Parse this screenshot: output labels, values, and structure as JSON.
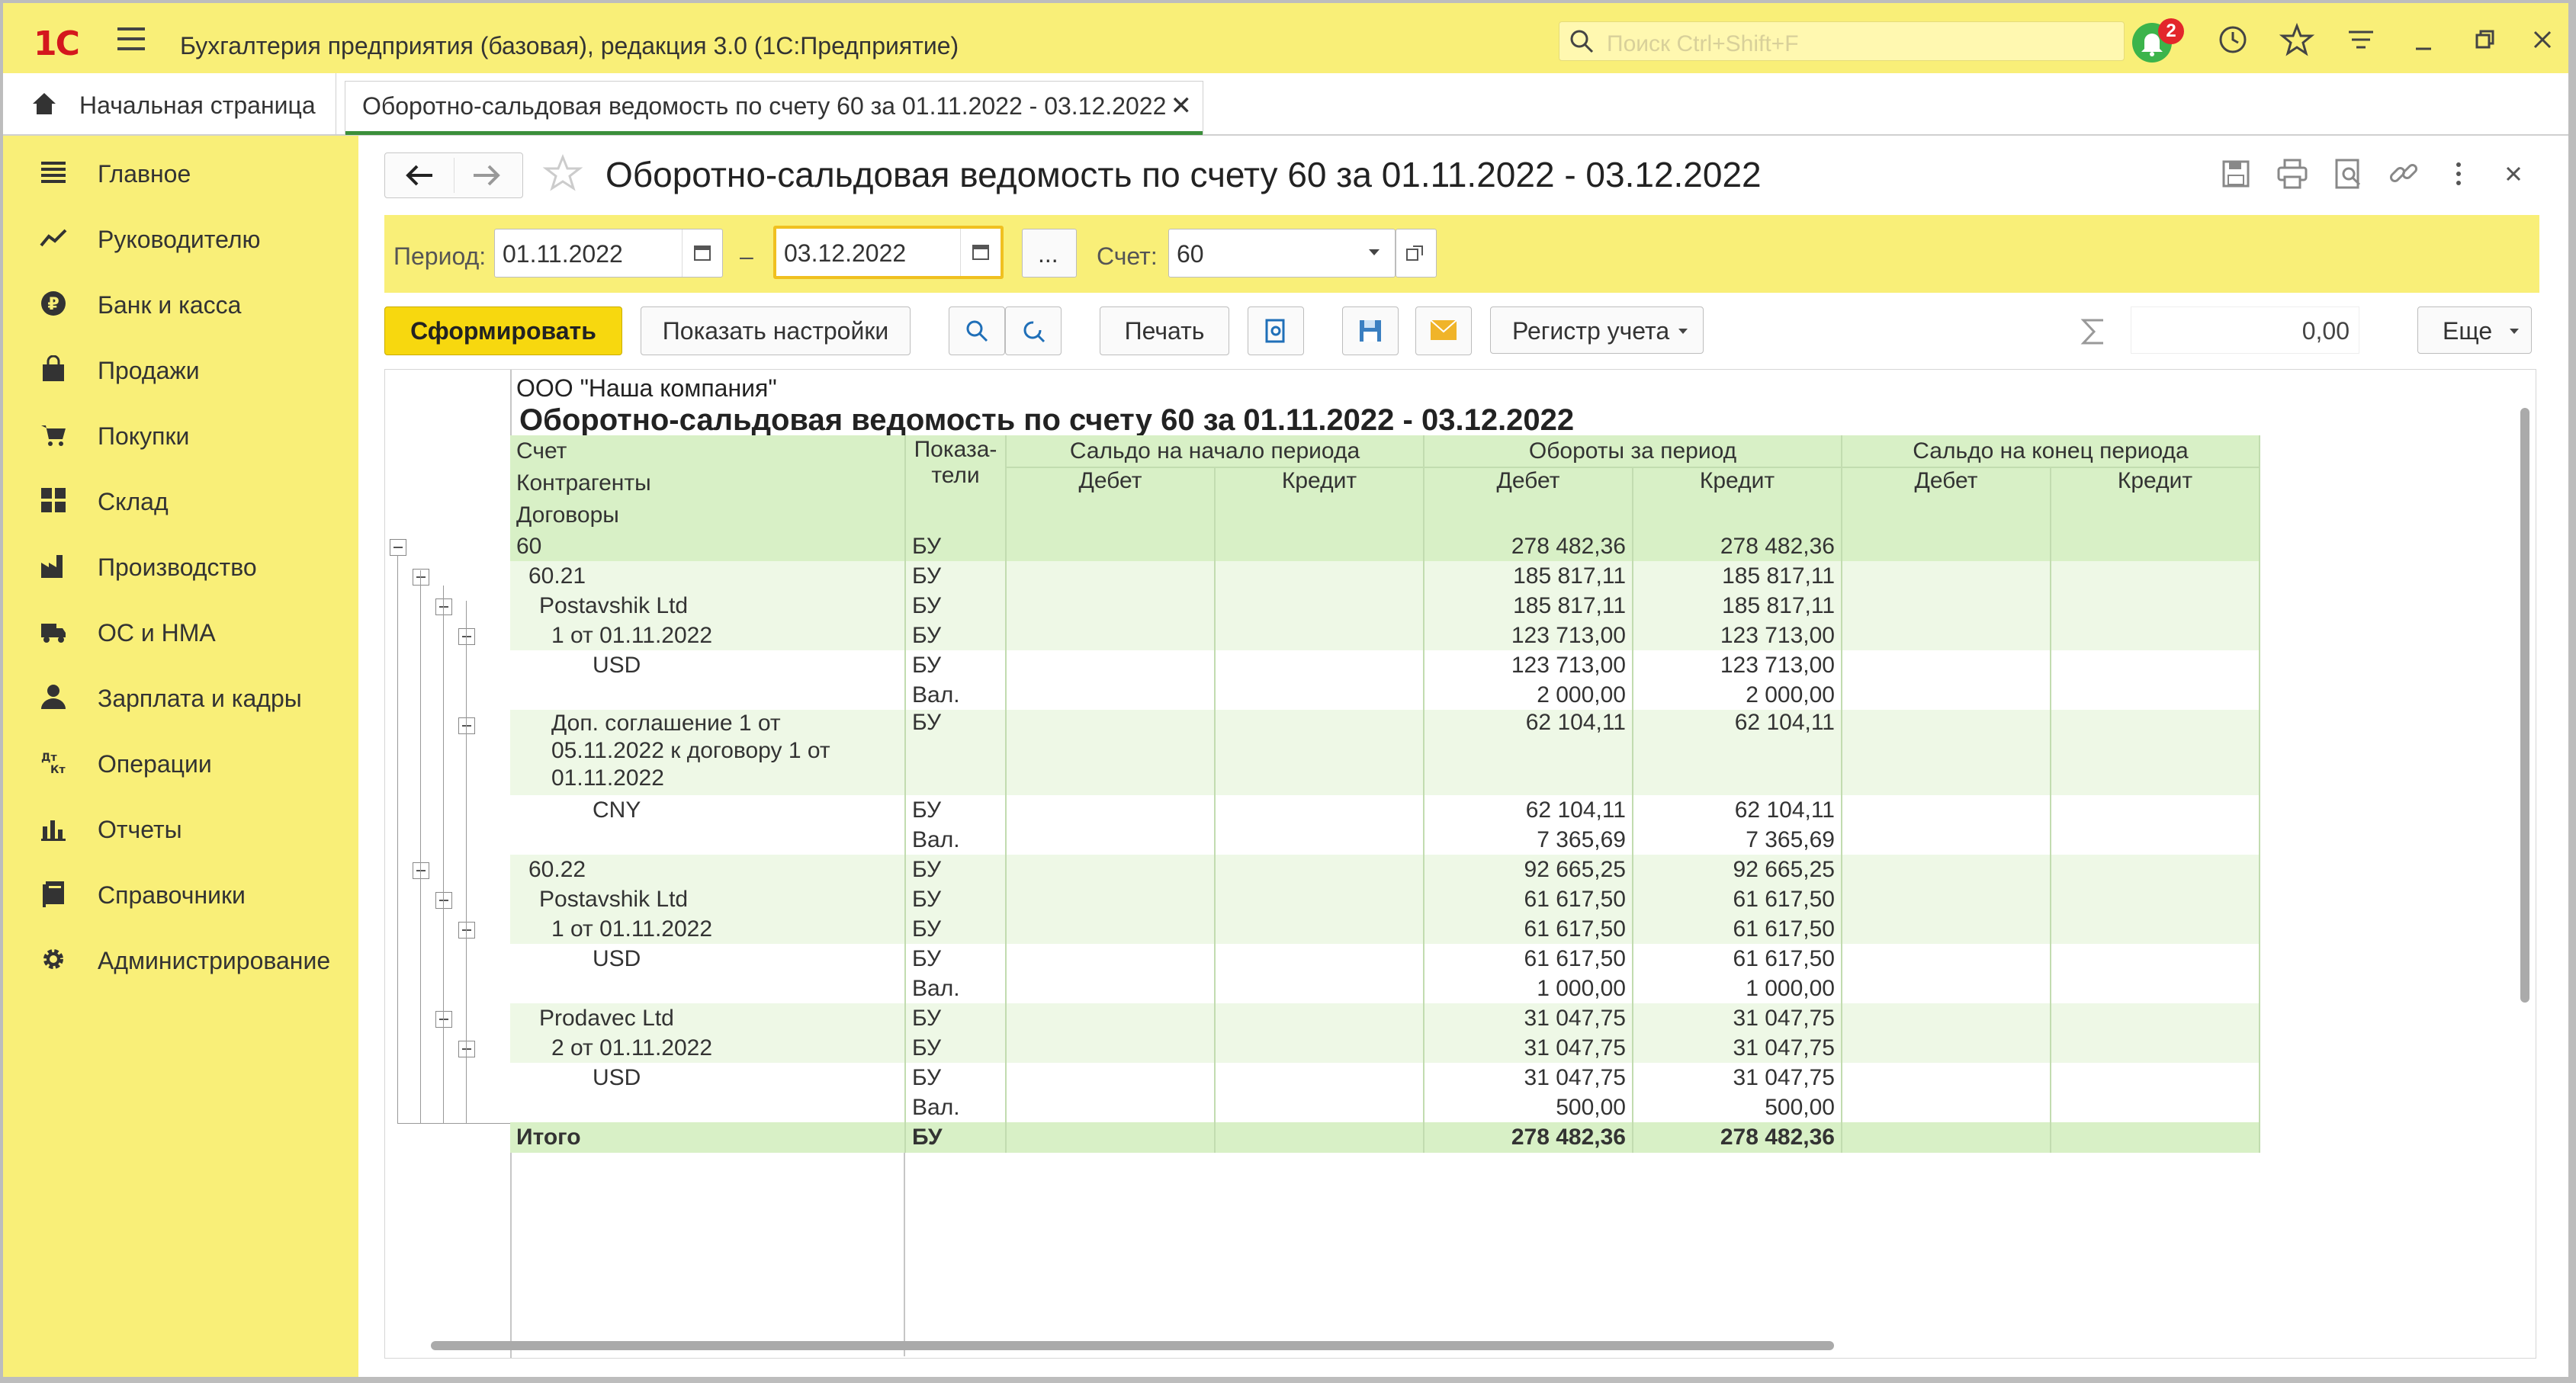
{
  "app": {
    "logo": "1С",
    "title": "Бухгалтерия предприятия (базовая), редакция 3.0  (1С:Предприятие)",
    "search_placeholder": "Поиск Ctrl+Shift+F",
    "notification_count": "2"
  },
  "tabs": {
    "home": "Начальная страница",
    "report": "Оборотно-сальдовая ведомость по счету 60 за 01.11.2022 - 03.12.2022"
  },
  "sidebar": {
    "items": [
      {
        "label": "Главное",
        "icon": "menu-icon"
      },
      {
        "label": "Руководителю",
        "icon": "trend-icon"
      },
      {
        "label": "Банк и касса",
        "icon": "ruble-icon"
      },
      {
        "label": "Продажи",
        "icon": "bag-icon"
      },
      {
        "label": "Покупки",
        "icon": "cart-icon"
      },
      {
        "label": "Склад",
        "icon": "grid-icon"
      },
      {
        "label": "Производство",
        "icon": "factory-icon"
      },
      {
        "label": "ОС и НМА",
        "icon": "truck-icon"
      },
      {
        "label": "Зарплата и кадры",
        "icon": "person-icon"
      },
      {
        "label": "Операции",
        "icon": "operations-icon"
      },
      {
        "label": "Отчеты",
        "icon": "bar-chart-icon"
      },
      {
        "label": "Справочники",
        "icon": "book-icon"
      },
      {
        "label": "Администрирование",
        "icon": "gear-icon"
      }
    ]
  },
  "header": {
    "title": "Оборотно-сальдовая ведомость по счету 60 за 01.11.2022 - 03.12.2022"
  },
  "filters": {
    "period_label": "Период:",
    "date_from": "01.11.2022",
    "dash": "–",
    "date_to": "03.12.2022",
    "dots": "...",
    "account_label": "Счет:",
    "account": "60"
  },
  "toolbar": {
    "generate": "Сформировать",
    "settings": "Показать настройки",
    "print": "Печать",
    "register": "Регистр учета",
    "sum_value": "0,00",
    "more": "Еще"
  },
  "report": {
    "company": "ООО \"Наша компания\"",
    "title": "Оборотно-сальдовая ведомость по счету 60 за 01.11.2022 - 03.12.2022",
    "headers": {
      "account": "Счет",
      "counterparties": "Контрагенты",
      "contracts": "Договоры",
      "indicators": "Показа-\nтели",
      "start_balance": "Сальдо на начало периода",
      "turnover": "Обороты за период",
      "end_balance": "Сальдо на конец периода",
      "debit": "Дебет",
      "credit": "Кредит"
    },
    "rows": [
      {
        "name": "60",
        "ind": "БУ",
        "debit": "278 482,36",
        "credit": "278 482,36",
        "style": "h"
      },
      {
        "name": "60.21",
        "ind": "БУ",
        "debit": "185 817,11",
        "credit": "185 817,11",
        "style": "d"
      },
      {
        "name": "Postavshik Ltd",
        "ind": "БУ",
        "debit": "185 817,11",
        "credit": "185 817,11",
        "style": "d"
      },
      {
        "name": "1 от 01.11.2022",
        "ind": "БУ",
        "debit": "123 713,00",
        "credit": "123 713,00",
        "style": "d"
      },
      {
        "name": "USD",
        "ind": "БУ",
        "debit": "123 713,00",
        "credit": "123 713,00",
        "style": "w"
      },
      {
        "name": "",
        "ind": "Вал.",
        "debit": "2 000,00",
        "credit": "2 000,00",
        "style": "w"
      },
      {
        "name": "Доп. соглашение 1 от 05.11.2022 к договору 1 от 01.11.2022",
        "ind": "БУ",
        "debit": "62 104,11",
        "credit": "62 104,11",
        "style": "d"
      },
      {
        "name": "CNY",
        "ind": "БУ",
        "debit": "62 104,11",
        "credit": "62 104,11",
        "style": "w"
      },
      {
        "name": "",
        "ind": "Вал.",
        "debit": "7 365,69",
        "credit": "7 365,69",
        "style": "w"
      },
      {
        "name": "60.22",
        "ind": "БУ",
        "debit": "92 665,25",
        "credit": "92 665,25",
        "style": "d"
      },
      {
        "name": "Postavshik Ltd",
        "ind": "БУ",
        "debit": "61 617,50",
        "credit": "61 617,50",
        "style": "d"
      },
      {
        "name": "1 от 01.11.2022",
        "ind": "БУ",
        "debit": "61 617,50",
        "credit": "61 617,50",
        "style": "d"
      },
      {
        "name": "USD",
        "ind": "БУ",
        "debit": "61 617,50",
        "credit": "61 617,50",
        "style": "w"
      },
      {
        "name": "",
        "ind": "Вал.",
        "debit": "1 000,00",
        "credit": "1 000,00",
        "style": "w"
      },
      {
        "name": "Prodavec Ltd",
        "ind": "БУ",
        "debit": "31 047,75",
        "credit": "31 047,75",
        "style": "d"
      },
      {
        "name": "2 от 01.11.2022",
        "ind": "БУ",
        "debit": "31 047,75",
        "credit": "31 047,75",
        "style": "d"
      },
      {
        "name": "USD",
        "ind": "БУ",
        "debit": "31 047,75",
        "credit": "31 047,75",
        "style": "w"
      },
      {
        "name": "",
        "ind": "Вал.",
        "debit": "500,00",
        "credit": "500,00",
        "style": "w"
      }
    ],
    "total": {
      "name": "Итого",
      "ind": "БУ",
      "debit": "278 482,36",
      "credit": "278 482,36"
    }
  },
  "colors": {
    "accent_yellow": "#f9ef78",
    "table_header": "#d8f0c6",
    "table_row": "#eef8e6"
  }
}
